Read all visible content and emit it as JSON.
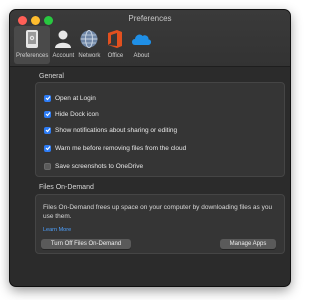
{
  "window": {
    "title": "Preferences"
  },
  "toolbar": {
    "items": [
      {
        "label": "Preferences",
        "icon": "phone-settings-icon",
        "active": true
      },
      {
        "label": "Account",
        "icon": "person-icon",
        "active": false
      },
      {
        "label": "Network",
        "icon": "globe-icon",
        "active": false
      },
      {
        "label": "Office",
        "icon": "office-logo-icon",
        "active": false
      },
      {
        "label": "About",
        "icon": "onedrive-cloud-icon",
        "active": false
      }
    ]
  },
  "general": {
    "title": "General",
    "options": [
      {
        "label": "Open at Login",
        "checked": true
      },
      {
        "label": "Hide Dock icon",
        "checked": true
      },
      {
        "label": "Show notifications about sharing or editing",
        "checked": true
      },
      {
        "label": "Warn me before removing files from the cloud",
        "checked": true
      },
      {
        "label": "Save screenshots to OneDrive",
        "checked": false
      }
    ]
  },
  "files_on_demand": {
    "title": "Files On-Demand",
    "description": "Files On-Demand frees up space on your computer by downloading files as you use them.",
    "learn_more": "Learn More",
    "turn_off_button": "Turn Off Files On-Demand",
    "manage_apps_button": "Manage Apps"
  },
  "colors": {
    "accent": "#2d7cf6",
    "link": "#4ea1ff",
    "window_bg": "#2b2b2b",
    "panel_bg": "#353535"
  }
}
